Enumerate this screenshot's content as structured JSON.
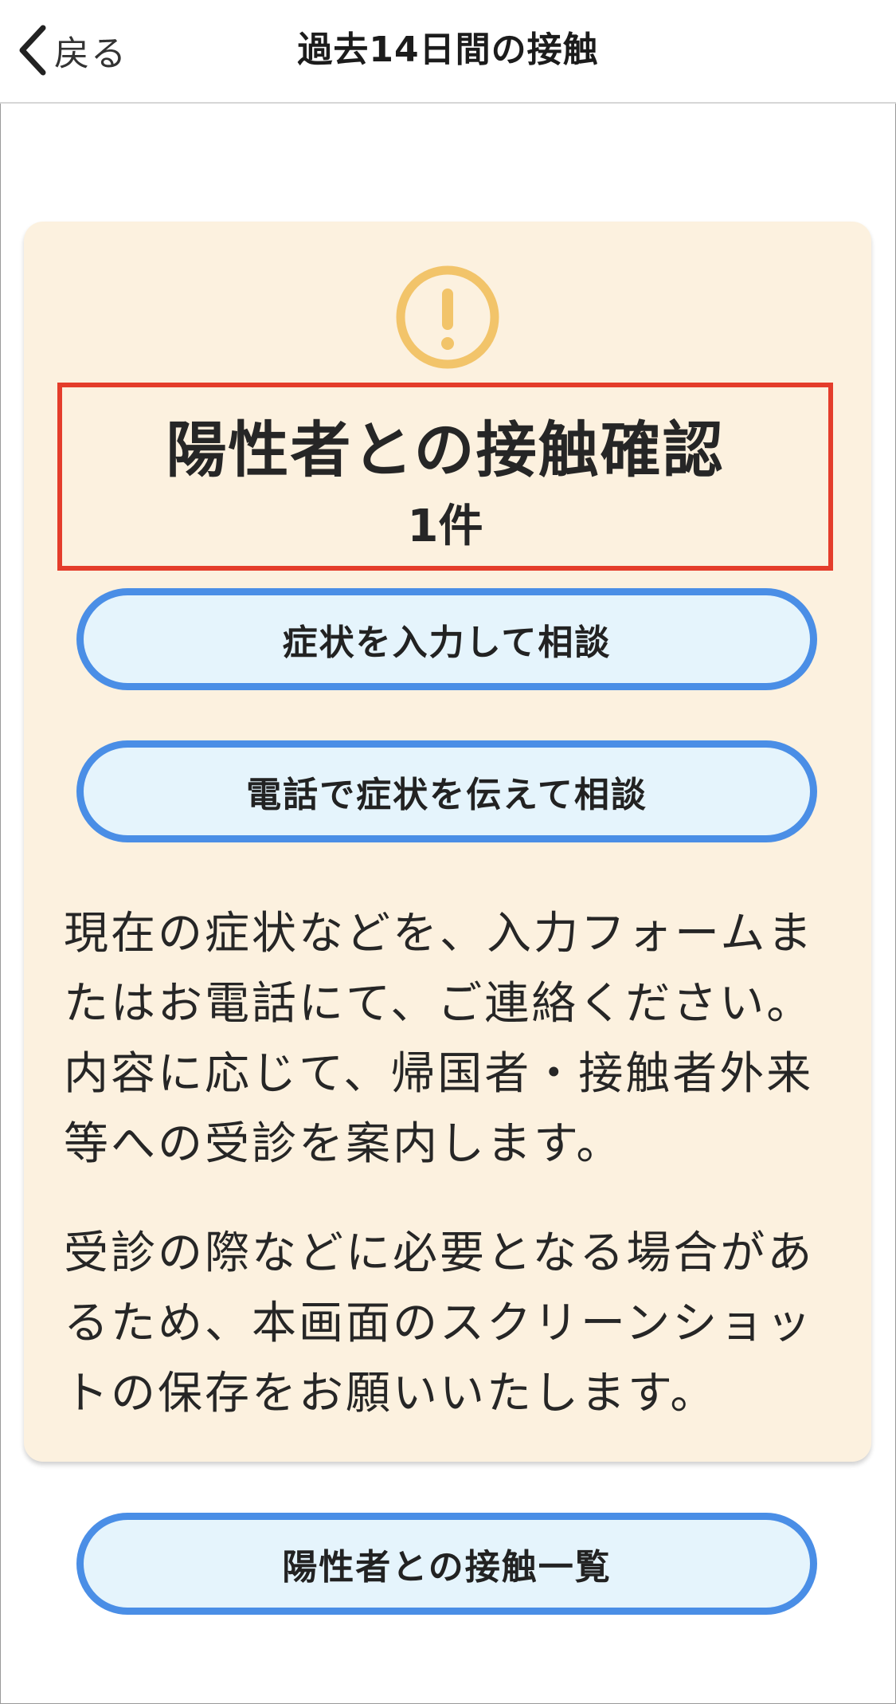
{
  "navbar": {
    "back_label": "戻る",
    "title": "過去14日間の接触"
  },
  "card": {
    "icon": "exclamation-circle-icon",
    "contact_title": "陽性者との接触確認",
    "contact_count": "1件",
    "consult_input_button": "症状を入力して相談",
    "consult_phone_button": "電話で症状を伝えて相談",
    "paragraph_1": "現在の症状などを、入力フォームまたはお電話にて、ご連絡ください。内容に応じて、帰国者・接触者外来等への受診を案内します。",
    "paragraph_2": "受診の際などに必要となる場合があるため、本画面のスクリーンショットの保存をお願いいたします。"
  },
  "list_button": "陽性者との接触一覧",
  "colors": {
    "card_background": "#fcf1df",
    "icon_accent": "#f2c46a",
    "button_border": "#4a8ee6",
    "button_fill": "#e5f4fc",
    "highlight_border": "#e43d2b"
  }
}
